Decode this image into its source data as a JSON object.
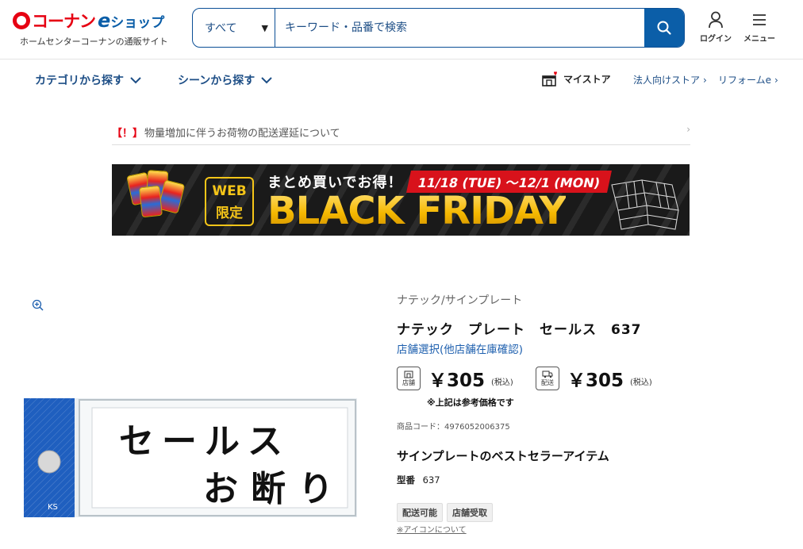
{
  "header": {
    "logo_text": "コーナン",
    "logo_e": "e",
    "logo_shop": "ショップ",
    "logo_sub": "ホームセンターコーナンの通販サイト",
    "search": {
      "category": "すべて",
      "placeholder": "キーワード・品番で検索"
    },
    "login_label": "ログイン",
    "menu_label": "メニュー"
  },
  "nav": {
    "category": "カテゴリから探す",
    "scene": "シーンから探す",
    "mystore": "マイストア",
    "corporate": "法人向けストア",
    "reform": "リフォームe"
  },
  "notice": {
    "mark": "【！】",
    "text": "物量増加に伴うお荷物の配送遅延について"
  },
  "banner": {
    "badge_top": "WEB",
    "badge_bottom": "限定",
    "catch": "まとめ買いでお得！",
    "date": "11/18 (TUE) ～12/1 (MON)",
    "title": "BLACK FRIDAY"
  },
  "product": {
    "brand": "ナテック/サインプレート",
    "name": "ナテック　プレート　セールス　637",
    "store_link": "店舗選択(他店舗在庫確認)",
    "store_badge": "店舗",
    "store_price": "￥305",
    "delivery_badge": "配送",
    "delivery_price": "￥305",
    "tax_label": "(税込)",
    "ref_note": "※上記は参考価格です",
    "code": "商品コード：4976052006375",
    "tagline": "サインプレートのベストセラーアイテム",
    "model_label": "型番",
    "model_value": "637",
    "tags": [
      "配送可能",
      "店舗受取"
    ],
    "icon_note": "※アイコンについて",
    "plate_line1": "セールス",
    "plate_line2": "お断り"
  },
  "colors": {
    "brand_red": "#e60012",
    "brand_blue": "#0b5ea8",
    "link_blue": "#1d5fae"
  }
}
